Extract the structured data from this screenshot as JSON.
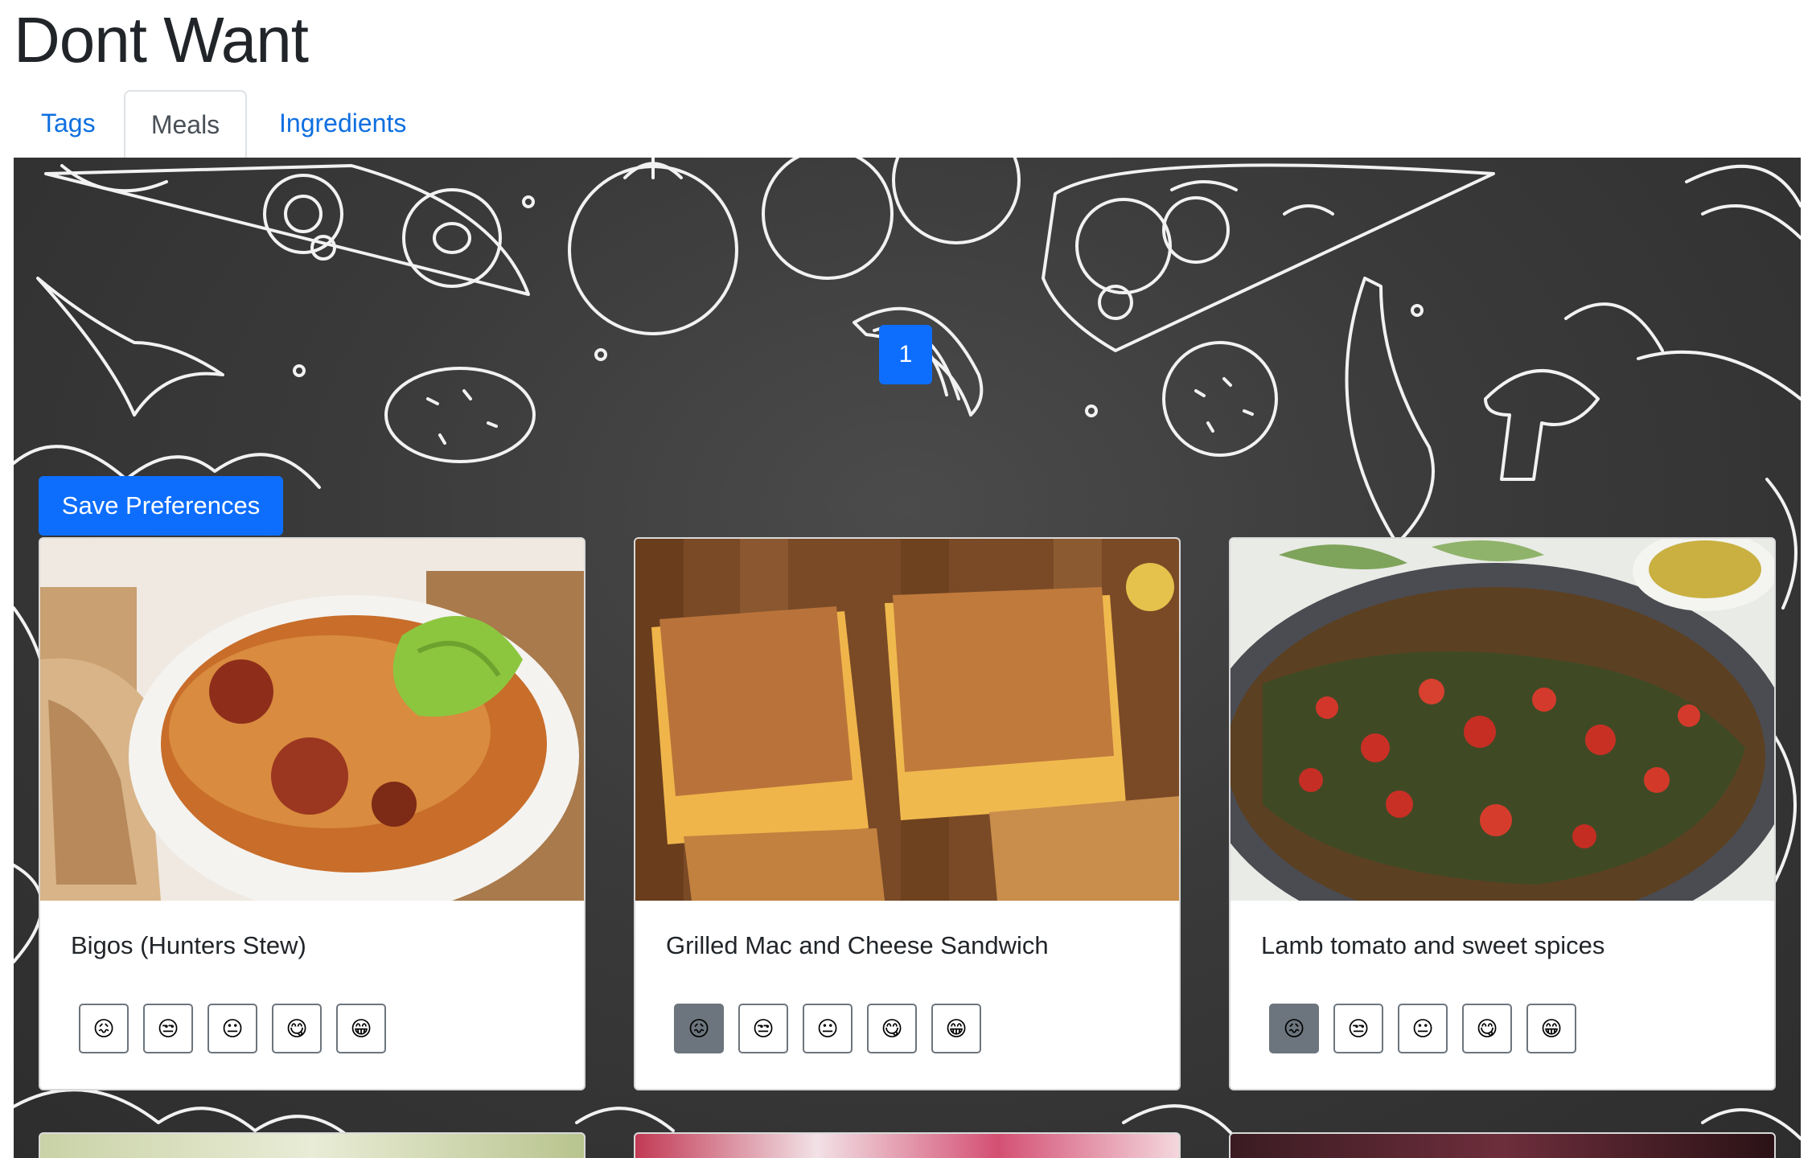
{
  "app": {
    "title": "Dont Want"
  },
  "tabs": [
    {
      "label": "Tags",
      "active": false
    },
    {
      "label": "Meals",
      "active": true
    },
    {
      "label": "Ingredients",
      "active": false
    }
  ],
  "pagination": {
    "current_page": "1"
  },
  "actions": {
    "save_label": "Save Preferences"
  },
  "colors": {
    "primary": "#0d6efd",
    "link": "#0f6fe0",
    "rating_selected": "#6c757d",
    "board_background": "#3a3a3a"
  },
  "rating_scale": [
    "😖",
    "😒",
    "😐",
    "😋",
    "😁"
  ],
  "meals": [
    {
      "name": "Bigos (Hunters Stew)",
      "image": "stew-bowl-photo",
      "selected_rating": null
    },
    {
      "name": "Grilled Mac and Cheese Sandwich",
      "image": "grilled-sandwich-photo",
      "selected_rating": 1
    },
    {
      "name": "Lamb tomato and sweet spices",
      "image": "stuffed-leaves-pan-photo",
      "selected_rating": 1
    }
  ]
}
